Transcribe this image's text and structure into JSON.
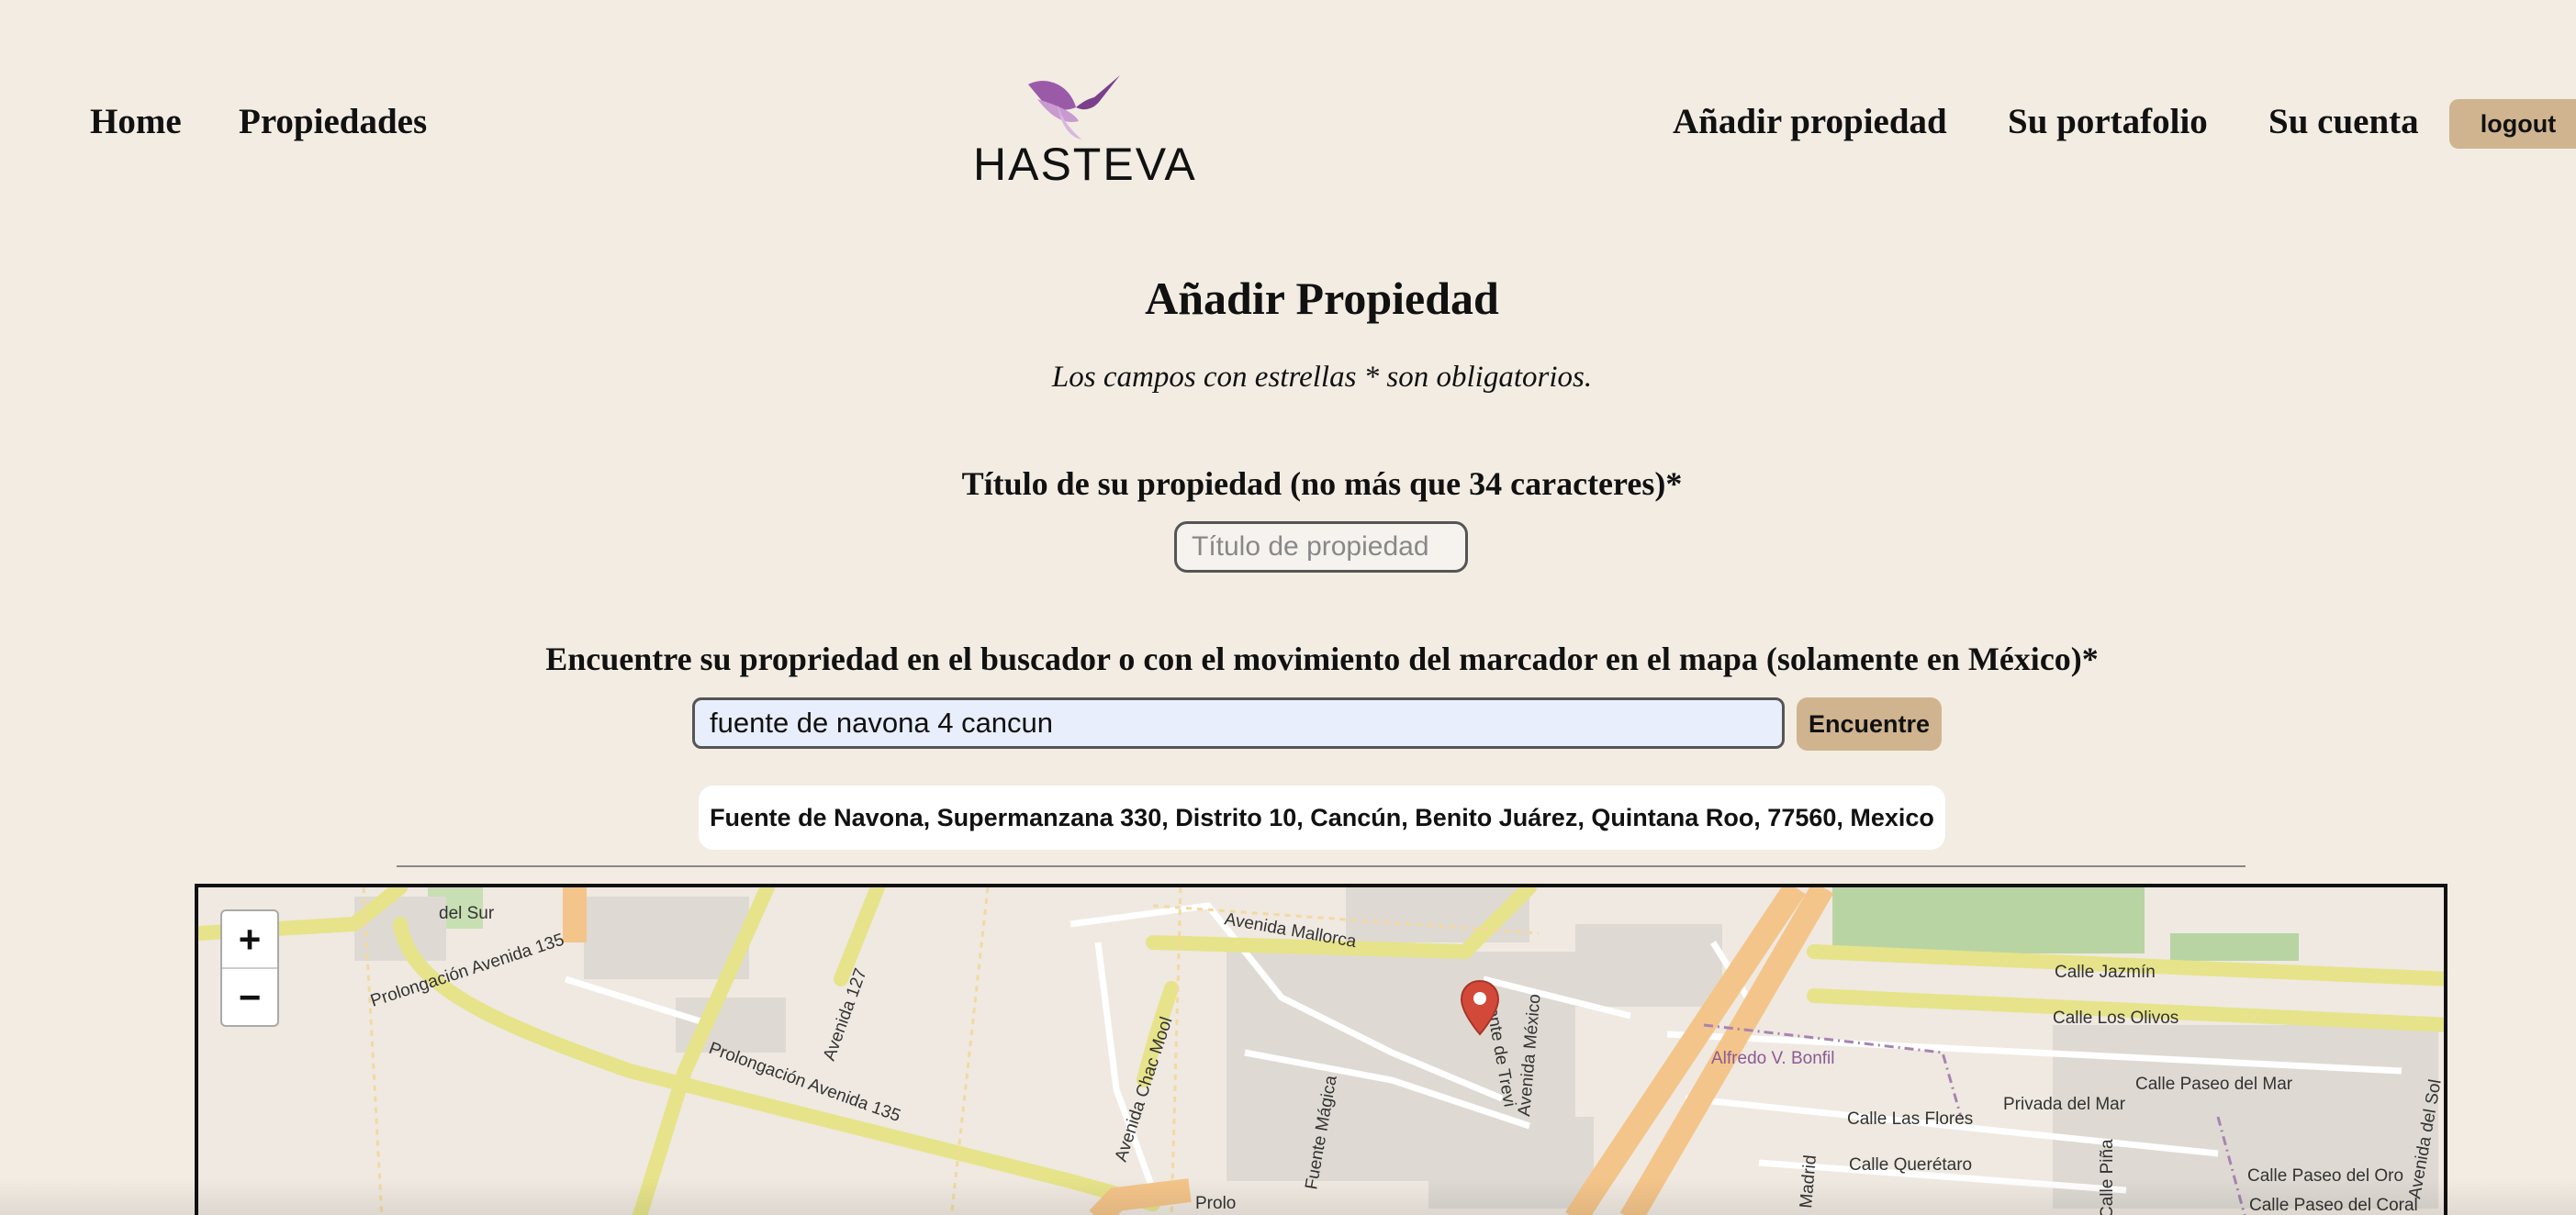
{
  "nav": {
    "home": "Home",
    "properties": "Propiedades",
    "add_property": "Añadir propiedad",
    "portfolio": "Su portafolio",
    "account": "Su cuenta",
    "logout": "logout"
  },
  "logo": {
    "text": "HASTEVA"
  },
  "form": {
    "title": "Añadir Propiedad",
    "hint": "Los campos con estrellas * son obligatorios.",
    "title_label": "Título de su propiedad (no más que 34 caracteres)*",
    "title_placeholder": "Título de propiedad",
    "location_label": "Encuentre su propriedad en el buscador o con el movimiento del marcador en el mapa (solamente en México)*",
    "search_value": "fuente de navona 4 cancun",
    "search_button": "Encuentre",
    "result": "Fuente de Navona, Supermanzana 330, Distrito 10, Cancún, Benito Juárez, Quintana Roo, 77560, Mexico"
  },
  "map": {
    "zoom_in": "+",
    "zoom_out": "−",
    "labels": {
      "del_sur": "del Sur",
      "prol_135_a": "Prolongación Avenida 135",
      "prol_135_b": "Prolongación Avenida 135",
      "av_127": "Avenida 127",
      "av_chac_mool": "Avenida Chac Mool",
      "av_mallorca": "Avenida Mallorca",
      "fuente_magica": "Fuente Mágica",
      "fuente_trevi": "Fuente de Trevi",
      "av_mexico": "Avenida México",
      "alfredo_bonfil": "Alfredo V. Bonfil",
      "calle_jazmin": "Calle Jazmín",
      "calle_olivos": "Calle Los Olivos",
      "calle_paseo_mar": "Calle Paseo del Mar",
      "privada_mar": "Privada del Mar",
      "calle_flores": "Calle Las Flores",
      "calle_queretaro": "Calle Querétaro",
      "calle_paseo_oro": "Calle Paseo del Oro",
      "calle_paseo_coral": "Calle Paseo del Coral",
      "calle_sol": "Avenida del Sol",
      "madrid": "Madrid",
      "calle_pina": "Calle Piña",
      "prolo": "Prolo"
    }
  },
  "colors": {
    "background": "#f2ece3",
    "button": "#cfb48f",
    "marker": "#d2493a",
    "road_orange": "#f4c58a",
    "road_yellow": "#f0f0a6"
  }
}
